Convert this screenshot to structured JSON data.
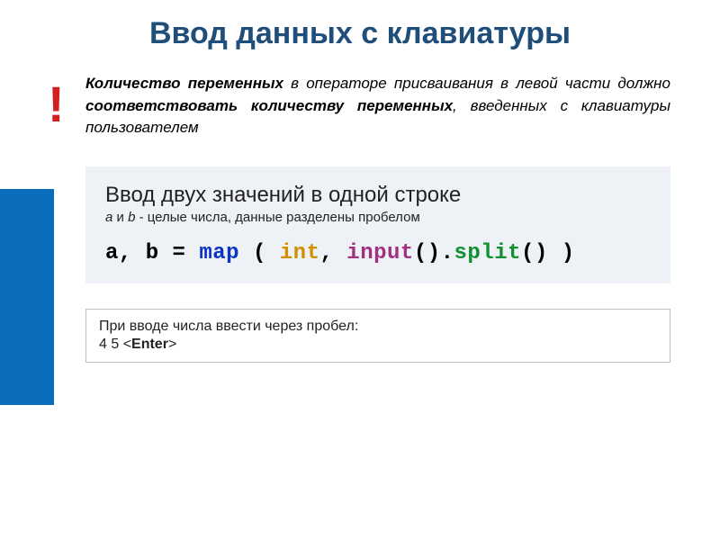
{
  "title": "Ввод данных с клавиатуры",
  "rule": {
    "bang": "!",
    "s1a": "Количество переменных",
    "s1b": " в операторе присваивания в левой части должно ",
    "s1c": "соответствовать количеству переменных",
    "s1d": ", введенных с клавиатуры пользователем"
  },
  "example": {
    "heading": "Ввод двух значений в одной строке",
    "sub_a": "a",
    "sub_b": " и ",
    "sub_c": "b",
    "sub_d": " - целые числа, данные разделены пробелом",
    "code": {
      "pre": "a, b = ",
      "map": "map",
      "mid1": " ( ",
      "int": "int",
      "mid2": ", ",
      "input": "input",
      "par": "().",
      "split": "split",
      "tail": "() )"
    }
  },
  "footer": {
    "line1": "При вводе числа ввести через пробел:",
    "line2_a": "4  5  <",
    "line2_b": "Enter",
    "line2_c": ">"
  }
}
